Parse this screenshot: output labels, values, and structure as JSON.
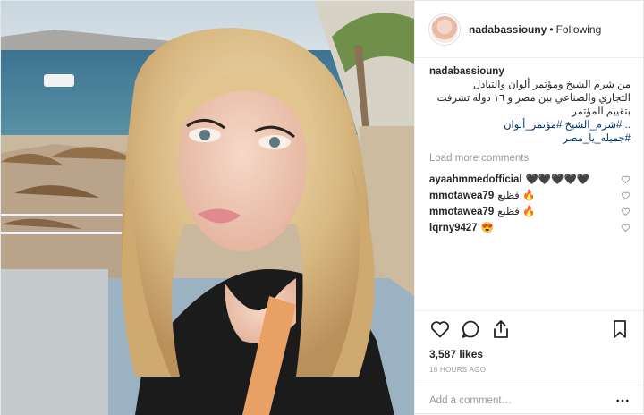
{
  "header": {
    "username": "nadabassiouny",
    "separator": "•",
    "follow_status": "Following"
  },
  "caption": {
    "username": "nadabassiouny",
    "lines": [
      "من شرم الشيخ ومؤتمر ألوان والتبادل",
      "التجاري والصناعي بين مصر و ١٦ دوله تشرفت بتقييم المؤتمر"
    ],
    "hashtags": ".. #شرم_الشيخ #مؤتمر_ألوان",
    "hashtag2": "#جميله_يا_مصر"
  },
  "load_more": "Load more comments",
  "comments": [
    {
      "user": "ayaahmmedofficial",
      "text": "🖤🖤🖤🖤🖤"
    },
    {
      "user": "mmotawea79",
      "text": "فظيع 🔥"
    },
    {
      "user": "mmotawea79",
      "text": "فظيع 🔥"
    },
    {
      "user": "lqrny9427",
      "text": "😍"
    }
  ],
  "icons": {
    "like": "heart-icon",
    "comment": "comment-bubble-icon",
    "share": "share-icon",
    "save": "bookmark-icon",
    "comment_like": "small-heart-icon",
    "options": "more-options-icon"
  },
  "likes": "3,587 likes",
  "time_ago": "18 HOURS AGO",
  "add_comment": {
    "placeholder": "Add a comment…"
  },
  "colors": {
    "link": "#003569",
    "muted": "#999999",
    "text": "#262626"
  }
}
